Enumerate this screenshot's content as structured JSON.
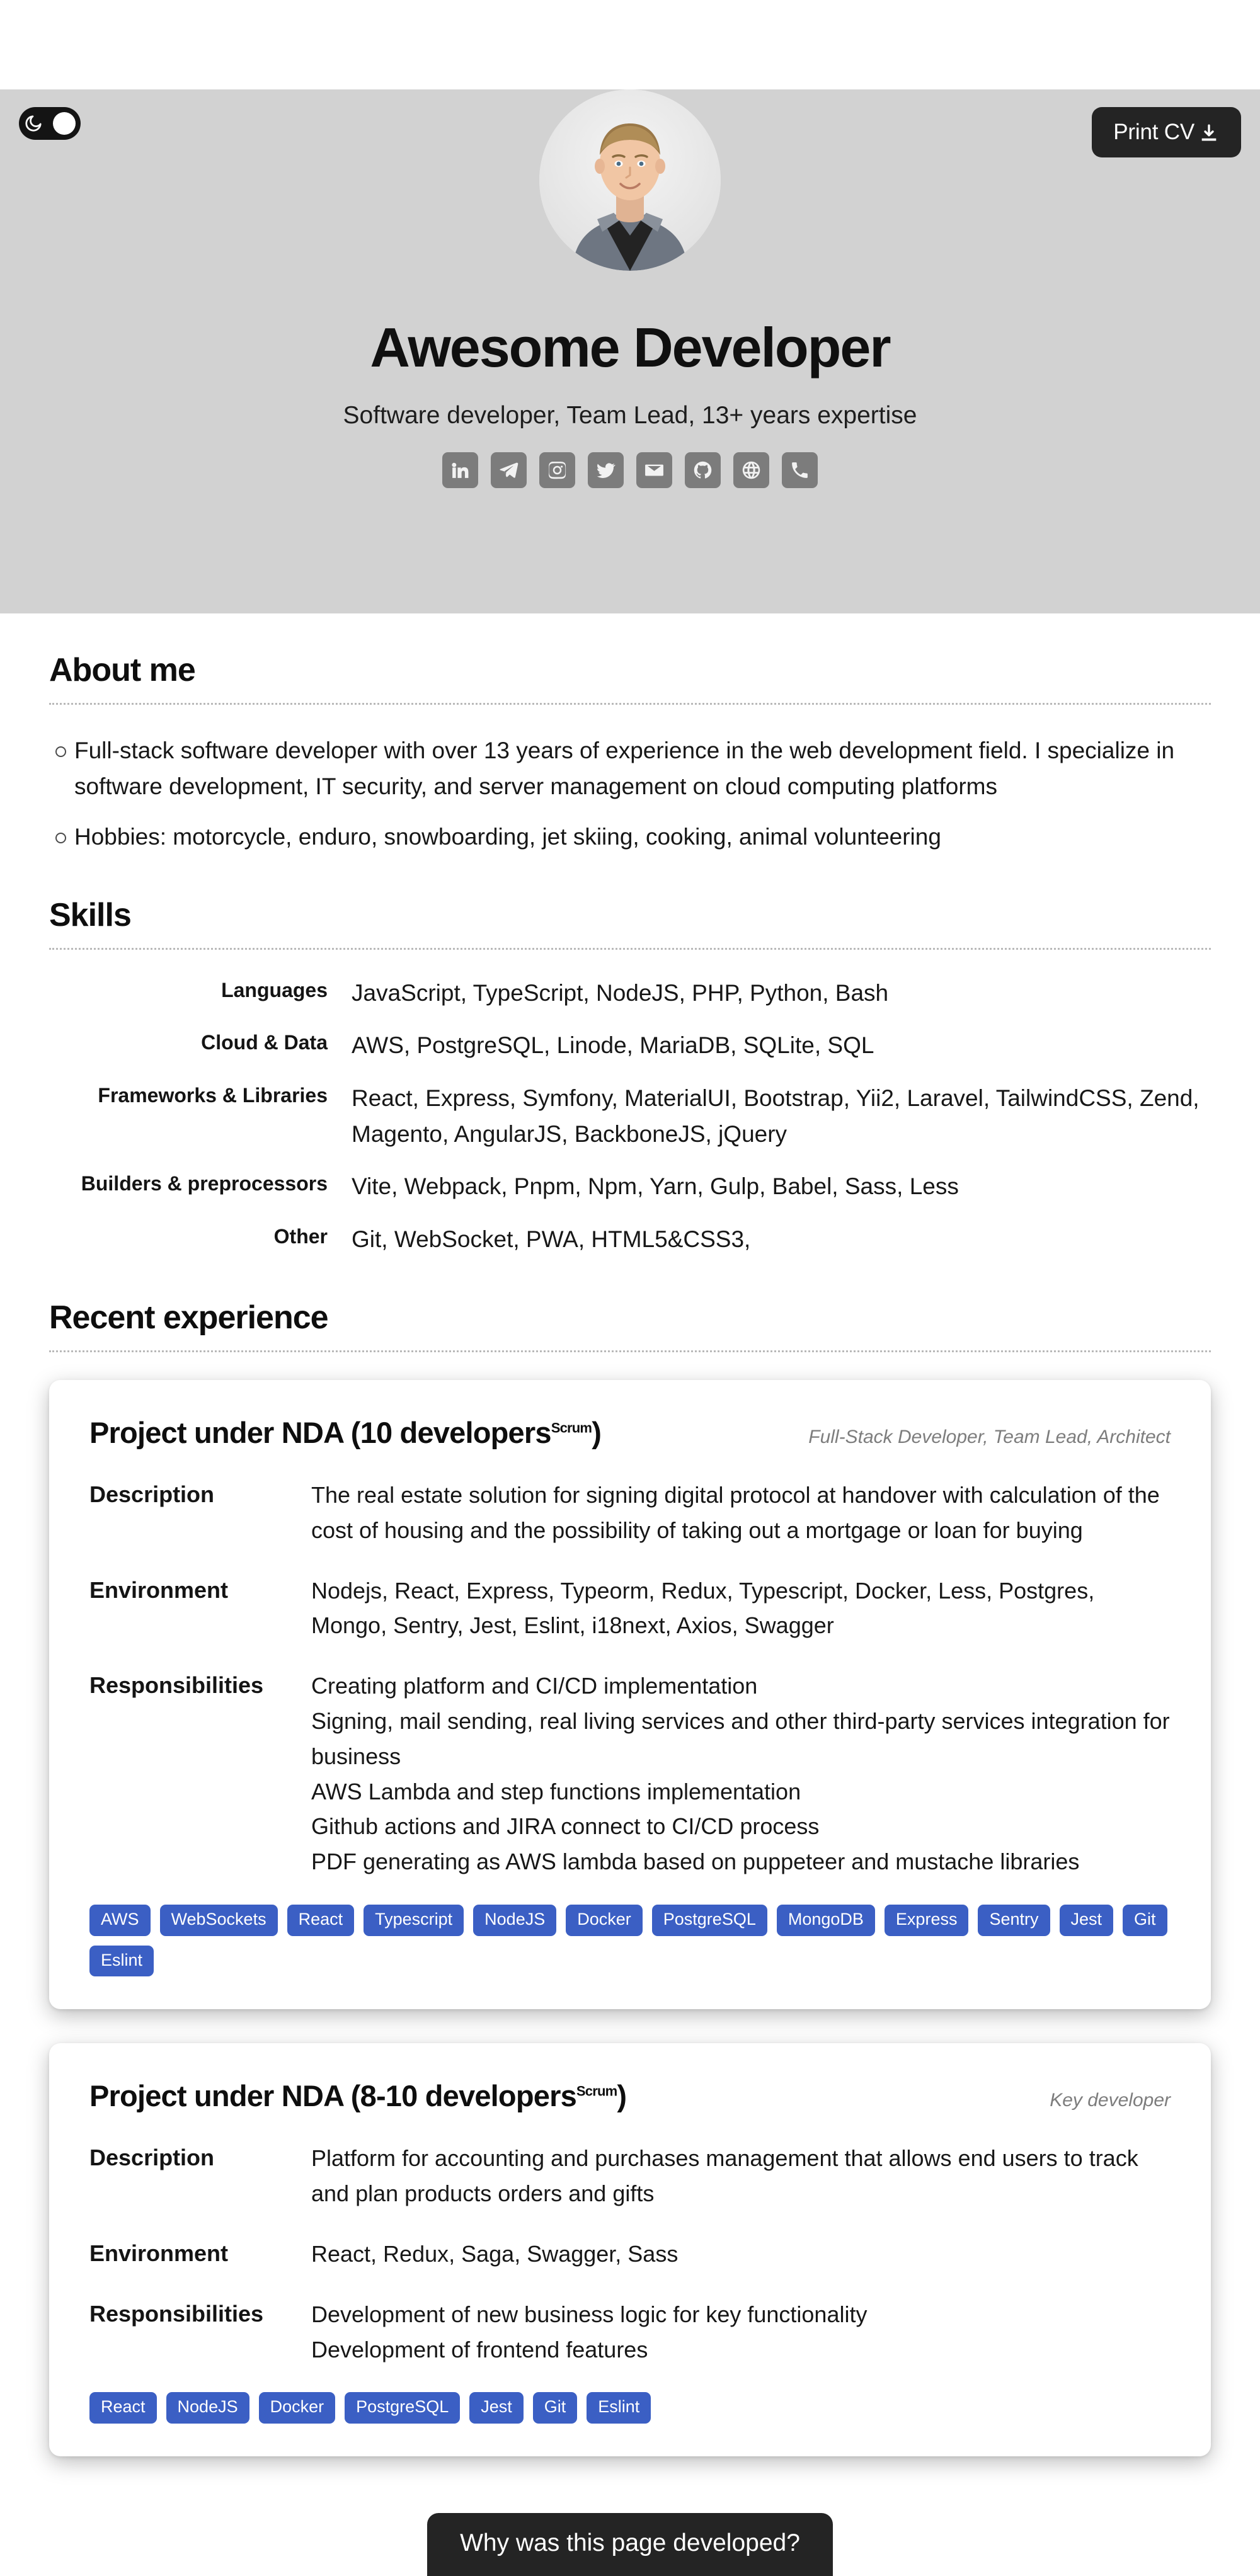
{
  "header": {
    "theme_toggle": {
      "icon": "moon-icon",
      "state": "dark"
    },
    "print_button": {
      "label": "Print CV",
      "icon": "download-icon"
    },
    "avatar_alt": "profile-photo",
    "name": "Awesome Developer",
    "subtitle": "Software developer, Team Lead, 13+ years expertise",
    "socials": [
      {
        "name": "linkedin-icon",
        "label": "LinkedIn"
      },
      {
        "name": "telegram-icon",
        "label": "Telegram"
      },
      {
        "name": "instagram-icon",
        "label": "Instagram"
      },
      {
        "name": "twitter-icon",
        "label": "Twitter"
      },
      {
        "name": "email-icon",
        "label": "Email"
      },
      {
        "name": "github-icon",
        "label": "GitHub"
      },
      {
        "name": "globe-icon",
        "label": "Website"
      },
      {
        "name": "phone-icon",
        "label": "Phone"
      }
    ]
  },
  "about": {
    "title": "About me",
    "items": [
      "Full-stack software developer with over 13 years of experience in the web development field. I specialize in software development, IT security, and server management on cloud computing platforms",
      "Hobbies: motorcycle, enduro, snowboarding, jet skiing, cooking, animal volunteering"
    ]
  },
  "skills": {
    "title": "Skills",
    "rows": [
      {
        "label": "Languages",
        "value": "JavaScript, TypeScript, NodeJS, PHP, Python, Bash"
      },
      {
        "label": "Cloud & Data",
        "value": "AWS, PostgreSQL, Linode, MariaDB, SQLite, SQL"
      },
      {
        "label": "Frameworks & Libraries",
        "value": "React, Express, Symfony, MaterialUI, Bootstrap, Yii2, Laravel, TailwindCSS, Zend, Magento, AngularJS, BackboneJS, jQuery"
      },
      {
        "label": "Builders & preprocessors",
        "value": "Vite, Webpack, Pnpm, Npm, Yarn, Gulp, Babel, Sass, Less"
      },
      {
        "label": "Other",
        "value": "Git, WebSocket, PWA, HTML5&CSS3,"
      }
    ]
  },
  "experience": {
    "title": "Recent experience",
    "row_labels": {
      "description": "Description",
      "environment": "Environment",
      "responsibilities": "Responsibilities"
    },
    "cards": [
      {
        "title": "Project under NDA (10 developers",
        "title_sup": "Scrum",
        "title_close": ")",
        "role": "Full-Stack Developer, Team Lead, Architect",
        "description": "The real estate solution for signing digital protocol at handover with calculation of the cost of housing and the possibility of taking out a mortgage or loan for buying",
        "environment": "Nodejs, React, Express, Typeorm, Redux, Typescript, Docker, Less, Postgres, Mongo, Sentry, Jest, Eslint, i18next, Axios, Swagger",
        "responsibilities": [
          "Creating platform and CI/CD implementation",
          "Signing, mail sending, real living services and other third-party services integration for business",
          "AWS Lambda and step functions implementation",
          "Github actions and JIRA connect to CI/CD process",
          "PDF generating as AWS lambda based on puppeteer and mustache libraries"
        ],
        "tags": [
          "AWS",
          "WebSockets",
          "React",
          "Typescript",
          "NodeJS",
          "Docker",
          "PostgreSQL",
          "MongoDB",
          "Express",
          "Sentry",
          "Jest",
          "Git",
          "Eslint"
        ]
      },
      {
        "title": "Project under NDA (8-10 developers",
        "title_sup": "Scrum",
        "title_close": ")",
        "role": "Key developer",
        "description": "Platform for accounting and purchases management that allows end users to track and plan products orders and gifts",
        "environment": "React, Redux, Saga, Swagger, Sass",
        "responsibilities": [
          "Development of new business logic for key functionality",
          "Development of frontend features"
        ],
        "tags": [
          "React",
          "NodeJS",
          "Docker",
          "PostgreSQL",
          "Jest",
          "Git",
          "Eslint"
        ]
      }
    ]
  },
  "footer": {
    "why_button": "Why was this page developed?"
  },
  "colors": {
    "header_bg": "#d2d2d2",
    "tag_blue": "#3b5fc4",
    "dark_button": "#242424",
    "social_icon_bg": "#7c7c7c"
  }
}
